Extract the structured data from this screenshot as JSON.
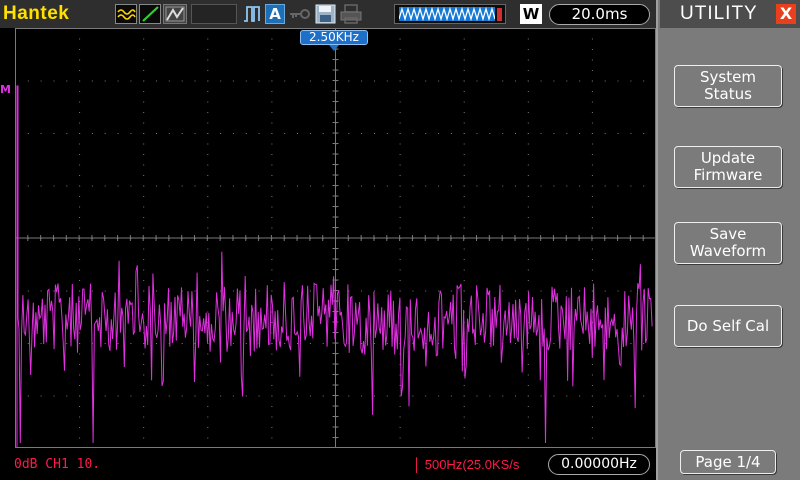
{
  "brand": "Hantek",
  "toolbar": {
    "icons": [
      "fft-math-icon",
      "line-icon",
      "persist-icon",
      "pulse-trigger-icon",
      "auto-icon",
      "key-lock-icon",
      "save-icon",
      "print-icon"
    ],
    "auto_label": "A",
    "mode_badge": "W",
    "timebase": "20.0ms"
  },
  "plot": {
    "frequency_marker": "2.50KHz",
    "reference_marker": "M",
    "trace_color": "#e030e0",
    "grid_color": "#7a7a7a"
  },
  "status": {
    "channel_scale": "0dB CH1 10.",
    "sample_info": "│ 500Hz(25.0KS/s",
    "frequency_readout": "0.00000Hz",
    "text_color": "#ff1a4a"
  },
  "menu": {
    "title": "UTILITY",
    "close_label": "X",
    "buttons": {
      "system_status": "System\nStatus",
      "update_firmware": "Update\nFirmware",
      "save_waveform": "Save\nWaveform",
      "self_cal": "Do Self Cal"
    },
    "page": "Page 1/4"
  }
}
